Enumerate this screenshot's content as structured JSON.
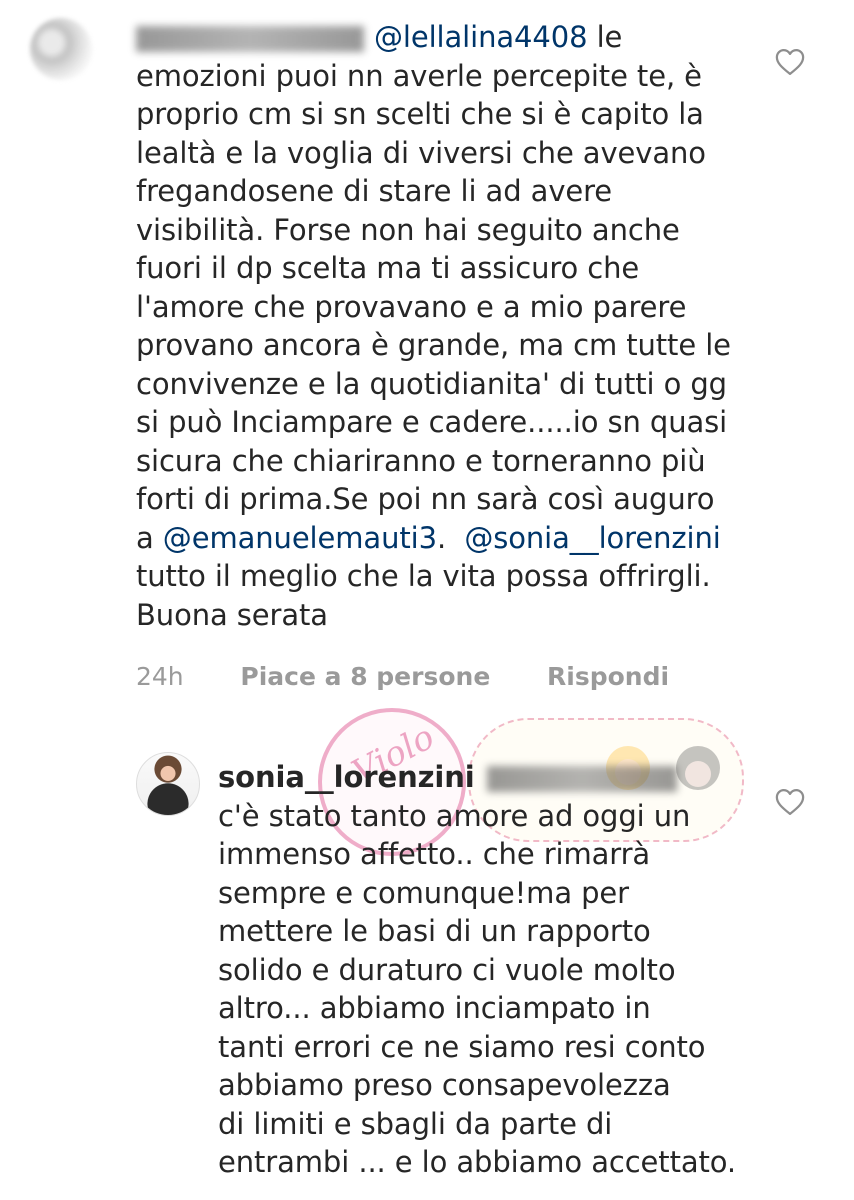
{
  "comments": [
    {
      "username": "",
      "mention_reply": "@lellalina4408",
      "lines_first": " le",
      "lines": [
        "emozioni puoi nn averle percepite te, è",
        "proprio cm si sn scelti che si è capito la",
        "lealtà e  la voglia di viversi che avevano",
        "fregandosene di stare li ad avere",
        "visibilità. Forse non hai seguito anche",
        "fuori il dp scelta ma ti assicuro che",
        "l'amore che provavano e a mio parere",
        "provano ancora è grande, ma cm tutte le",
        "convivenze e la  quotidianita' di tutti o gg",
        "si può Inciampare e cadere.....io sn quasi",
        "sicura che chiariranno e torneranno più",
        "forti di prima.Se poi nn sarà così auguro"
      ],
      "line_mentions_prefix": "a ",
      "mention_1": "@emanuelemauti3",
      "mention_gap": ".  ",
      "mention_2": "@sonia__lorenzini",
      "tail_lines": [
        "tutto il meglio che la vita possa offrirgli.",
        "Buona serata"
      ],
      "time": "24h",
      "likes": "Piace a 8 persone",
      "reply": "Rispondi"
    },
    {
      "username": "sonia__lorenzini",
      "lines": [
        "c'è stato tanto amore ad oggi un",
        "immenso affetto.. che rimarrà",
        "sempre e comunque!ma per",
        "mettere le basi di un rapporto",
        "solido e duraturo ci vuole molto",
        "altro... abbiamo inciampato in",
        "tanti errori ce ne siamo resi conto",
        "abbiamo preso consapevolezza",
        "di limiti e sbagli da parte di",
        "entrambi ... e lo abbiamo accettato."
      ]
    }
  ],
  "watermark": {
    "text": "Violo"
  },
  "colors": {
    "mention": "#003569",
    "meta": "#9a9a9a",
    "text": "#262626"
  },
  "icons": [
    "heart-outline-icon"
  ]
}
